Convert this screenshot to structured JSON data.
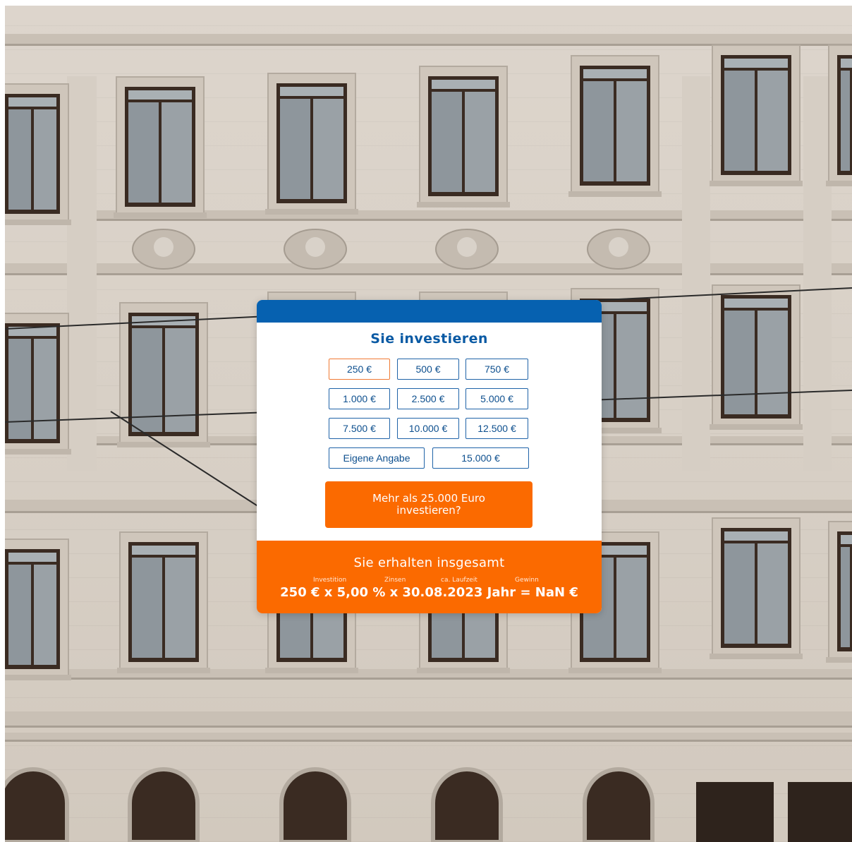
{
  "calculator": {
    "title": "Sie investieren",
    "amounts": [
      "250 €",
      "500 €",
      "750 €",
      "1.000 €",
      "2.500 €",
      "5.000 €",
      "7.500 €",
      "10.000 €",
      "12.500 €"
    ],
    "custom_label": "Eigene Angabe",
    "custom_value": "15.000 €",
    "selected": "250 €",
    "cta_label": "Mehr als 25.000 Euro investieren?",
    "accent_blue": "#0661b0",
    "accent_orange": "#fb6a00"
  },
  "result": {
    "title": "Sie erhalten insgesamt",
    "labels": {
      "investment": "Investition",
      "interest": "Zinsen",
      "term": "ca. Laufzeit",
      "profit": "Gewinn"
    },
    "formula": "250 € x 5,00 % x 30.08.2023 Jahr = NaN €"
  }
}
